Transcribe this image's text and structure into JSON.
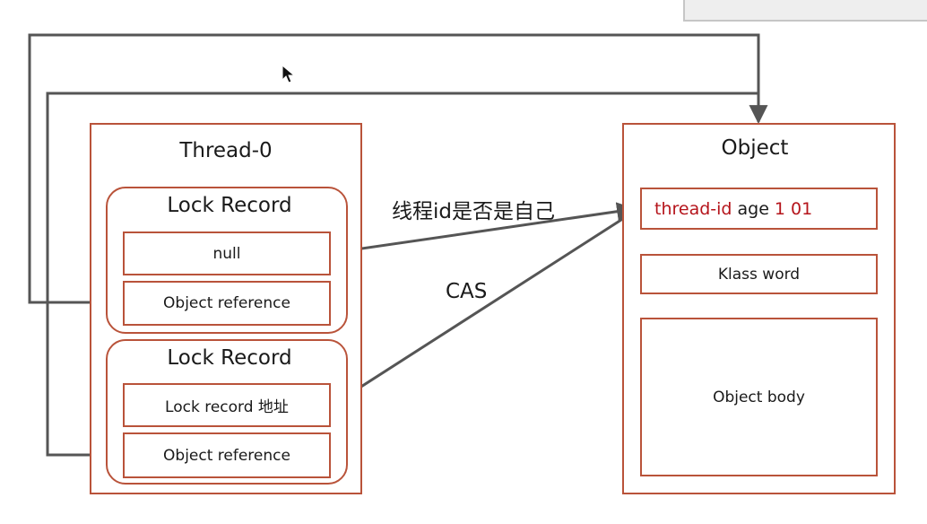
{
  "thread": {
    "title": "Thread-0",
    "record1": {
      "title": "Lock Record",
      "slot1": "null",
      "slot2": "Object reference"
    },
    "record2": {
      "title": "Lock Record",
      "slot1": "Lock record 地址",
      "slot2": "Object reference"
    }
  },
  "object": {
    "title": "Object",
    "mark_word": {
      "thread_id": "thread-id",
      "age": "age",
      "bits": "1 01"
    },
    "klass_word": "Klass word",
    "body": "Object body"
  },
  "labels": {
    "compare": "线程id是否是自己",
    "cas": "CAS"
  },
  "colors": {
    "border": "#b9533a",
    "accent_text": "#b5141b",
    "wire": "#555555"
  }
}
